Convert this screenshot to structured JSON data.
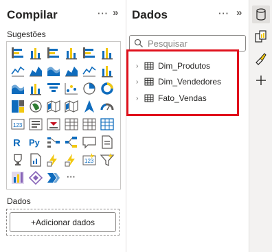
{
  "compilar": {
    "title": "Compilar",
    "more_label": "···",
    "collapse_label": "»",
    "suggestions_label": "Sugestões",
    "more_visuals_label": "···",
    "data_section_label": "Dados",
    "add_data_label": "+Adicionar dados"
  },
  "dados": {
    "title": "Dados",
    "more_label": "···",
    "collapse_label": "»",
    "search_placeholder": "Pesquisar",
    "tables": [
      {
        "name": "Dim_Produtos"
      },
      {
        "name": "Dim_Vendedores"
      },
      {
        "name": "Fato_Vendas"
      }
    ]
  },
  "colors": {
    "accent_blue": "#0f6cbd",
    "highlight_red": "#e0101c",
    "icon_yellow": "#f2c811",
    "icon_gray": "#605e5c"
  },
  "visuals": [
    "stacked-bar-chart-icon",
    "stacked-column-chart-icon",
    "clustered-bar-chart-icon",
    "clustered-column-chart-icon",
    "100-percent-bar-chart-icon",
    "100-percent-column-chart-icon",
    "line-chart-icon",
    "area-chart-icon",
    "stacked-area-chart-icon",
    "100-percent-area-chart-icon",
    "line-column-chart-icon",
    "line-clustered-column-chart-icon",
    "ribbon-chart-icon",
    "waterfall-chart-icon",
    "funnel-chart-icon",
    "scatter-chart-icon",
    "pie-chart-icon",
    "donut-chart-icon",
    "treemap-icon",
    "map-icon",
    "filled-map-icon",
    "shape-map-icon",
    "azure-map-icon",
    "gauge-icon",
    "card-icon",
    "multi-row-card-icon",
    "kpi-icon",
    "slicer-icon",
    "table-icon",
    "matrix-icon",
    "r-visual-icon",
    "python-visual-icon",
    "key-influencers-icon",
    "decomposition-tree-icon",
    "qa-icon",
    "narrative-icon",
    "goals-icon",
    "paginated-report-icon",
    "power-apps-icon",
    "power-automate-icon",
    "new-card-icon",
    "new-slicer-icon",
    "custom-visual-icon",
    "diamond-visual-icon",
    "chevron-visual-icon"
  ]
}
